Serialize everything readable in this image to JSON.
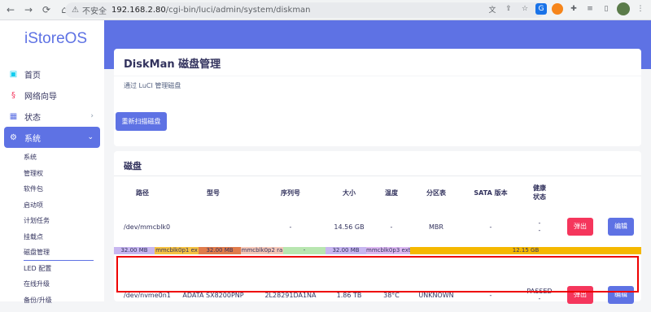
{
  "browser": {
    "insecure_label": "不安全",
    "url_host": "192.168.2.80",
    "url_path": "/cgi-bin/luci/admin/system/diskman"
  },
  "sidebar": {
    "logo": "iStoreOS",
    "items": [
      {
        "label": "首页",
        "icon": "home-icon"
      },
      {
        "label": "网络向导",
        "icon": "wizard-icon"
      },
      {
        "label": "状态",
        "icon": "status-icon"
      },
      {
        "label": "系统",
        "icon": "gear-icon"
      }
    ],
    "subitems": [
      "系统",
      "管理权",
      "软件包",
      "启动项",
      "计划任务",
      "挂载点",
      "磁盘管理",
      "LED 配置",
      "在线升级",
      "备份/升级"
    ]
  },
  "page": {
    "title": "DiskMan 磁盘管理",
    "description": "通过 LuCI 管理磁盘",
    "rescan_button": "重新扫描磁盘",
    "disk_section_title": "磁盘"
  },
  "disk_table": {
    "headers": [
      "路径",
      "型号",
      "序列号",
      "大小",
      "温度",
      "分区表",
      "SATA 版本",
      "健康\n状态",
      "",
      ""
    ],
    "rows": [
      {
        "path": "/dev/mmcblk0",
        "model": "",
        "serial": "-",
        "size": "14.56 GB",
        "temp": "-",
        "ptable": "MBR",
        "sata": "-",
        "health": "-\n-",
        "eject": "弹出",
        "edit": "编辑"
      },
      {
        "path": "/dev/nvme0n1",
        "model": "ADATA SX8200PNP",
        "serial": "2L28291DA1NA",
        "size": "1.86 TB",
        "temp": "38°C",
        "ptable": "UNKNOWN",
        "sata": "-",
        "health": "PASSED\n-",
        "eject": "弹出",
        "edit": "编辑"
      }
    ],
    "partitions": [
      {
        "label": "32.00 MB",
        "color": "#c7b6f0"
      },
      {
        "label": "mmcblk0p1 ex",
        "color": "#f5c242"
      },
      {
        "label": "32.00 MB",
        "color": "#e07b4b"
      },
      {
        "label": "mmcblk0p2 ra",
        "color": "#f3c6b6"
      },
      {
        "label": "-",
        "color": "#b8e6b0"
      },
      {
        "label": "32.00 MB",
        "color": "#c7b6f0"
      },
      {
        "label": "mmcblk0p3 ext",
        "color": "#dcb8f0"
      },
      {
        "label": "12.15 GB",
        "color": "#f5b800"
      }
    ]
  }
}
